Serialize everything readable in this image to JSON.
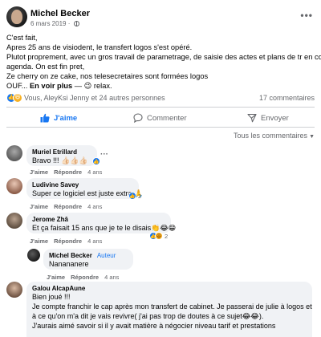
{
  "post": {
    "author": "Michel Becker",
    "date": "6 mars 2019",
    "date_sep": "·",
    "lines": [
      "C'est fait,",
      "Apres 25 ans de visiodent, le transfert logos s'est opéré.",
      "Plutot proprement, avec un gros travail de parametrage, de saisie des actes et plans de tr en cours,",
      "agenda. On est fin pret,",
      "Ze cherry on ze cake, nos telesecretaires  sont formées logos"
    ],
    "last_line_prefix": "OUF...",
    "see_more": "En voir plus",
    "last_line_suffix": "— 😉 relax.",
    "reactions_who": "Vous, AleyKsi Jenny et 24 autres personnes",
    "comments_count": "17 commentaires"
  },
  "actions": {
    "like": "J'aime",
    "comment": "Commenter",
    "share": "Envoyer"
  },
  "filter_label": "Tous les commentaires",
  "meta_labels": {
    "like": "J'aime",
    "reply": "Répondre"
  },
  "comments": [
    {
      "name": "Muriel Etrillard",
      "text": "Bravo !!! 👍🏻👍🏻👍🏻",
      "time": "4 ans"
    },
    {
      "name": "Ludivine Savey",
      "text": "Super ce logiciel est juste extra 🙏",
      "time": "4 ans",
      "reactions": "2"
    },
    {
      "name": "Jerome Zhâ",
      "text": "Et ça faisait 15 ans que je te le disais👏😂😁",
      "time": "4 ans",
      "reactions": "2"
    },
    {
      "name": "Michel Becker",
      "author_tag": "Auteur",
      "text": "Nanananere",
      "time": "4 ans"
    },
    {
      "name": "Galou AlcapAune",
      "lines": [
        "Bien joué !!!",
        "Je compte franchir le cap après mon transfert de cabinet. Je passerai de julie à logos et",
        "à ce qu'on m'a dit je vais revivre( j'ai pas trop de doutes à ce sujet😂😂).",
        "J'aurais aimé savoir si il y avait matière à négocier niveau tarif et prestations"
      ]
    }
  ],
  "colors": {
    "accent": "#1877f2",
    "bubble": "#f0f2f5",
    "secondary_text": "#65676b"
  },
  "icons": [
    "globe-icon",
    "more-icon",
    "like-reaction-icon",
    "haha-reaction-icon",
    "thumbs-up-icon",
    "comment-icon",
    "share-icon",
    "caret-down-icon"
  ]
}
